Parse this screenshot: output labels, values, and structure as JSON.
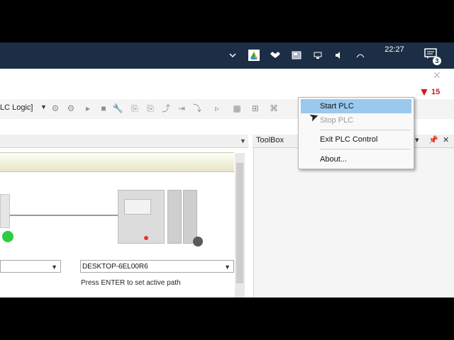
{
  "taskbar": {
    "tray_icons": [
      "chevron-up-icon",
      "google-drive-icon",
      "dropbox-icon",
      "plc-tray-icon",
      "network-icon",
      "volume-icon",
      "language-icon"
    ],
    "clock": "22:27",
    "notification_count": "3"
  },
  "toolbar": {
    "config_combo": "LC Logic]",
    "error_count": "15"
  },
  "device_panel": {
    "target_select": "DESKTOP-6EL00R6",
    "hint": "Press ENTER to set active path"
  },
  "toolbox": {
    "title": "ToolBox"
  },
  "context_menu": {
    "items": [
      {
        "label": "Start PLC",
        "state": "highlighted"
      },
      {
        "label": "Stop PLC",
        "state": "disabled"
      },
      {
        "label": "Exit PLC Control",
        "state": "normal"
      },
      {
        "label": "About...",
        "state": "normal"
      }
    ]
  },
  "colors": {
    "taskbar": "#1b2e45",
    "menu_highlight": "#99c9ef",
    "error": "#d0191e",
    "status_green": "#2ecc40"
  }
}
